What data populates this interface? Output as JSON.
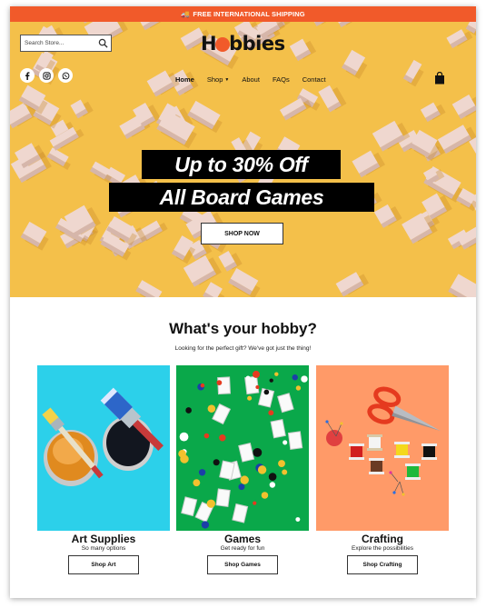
{
  "promo": {
    "text": "FREE INTERNATIONAL SHIPPING",
    "icon": "truck-icon"
  },
  "header": {
    "search_placeholder": "Search Store...",
    "logo_text_left": "H",
    "logo_text_right": "bbies",
    "nav": [
      {
        "label": "Home",
        "active": true,
        "has_menu": false
      },
      {
        "label": "Shop",
        "active": false,
        "has_menu": true
      },
      {
        "label": "About",
        "active": false,
        "has_menu": false
      },
      {
        "label": "FAQs",
        "active": false,
        "has_menu": false
      },
      {
        "label": "Contact",
        "active": false,
        "has_menu": false
      }
    ],
    "social": [
      "facebook-icon",
      "instagram-icon",
      "whatsapp-icon"
    ]
  },
  "hero": {
    "headline_line1": "Up to 30% Off",
    "headline_line2": "All Board Games",
    "cta": "SHOP NOW"
  },
  "hobbies": {
    "title": "What's your hobby?",
    "subtitle": "Looking for the perfect gift? We've got just the thing!",
    "cards": [
      {
        "title": "Art Supplies",
        "subtitle": "So many options",
        "button": "Shop Art",
        "bg": "#2cd0ea"
      },
      {
        "title": "Games",
        "subtitle": "Get ready for fun",
        "button": "Shop Games",
        "bg": "#0aa84a"
      },
      {
        "title": "Crafting",
        "subtitle": "Explore the possibilities",
        "button": "Shop Crafting",
        "bg": "#ff9a68"
      }
    ]
  },
  "colors": {
    "accent": "#f15a2a",
    "hero_bg": "#f4c04a"
  }
}
